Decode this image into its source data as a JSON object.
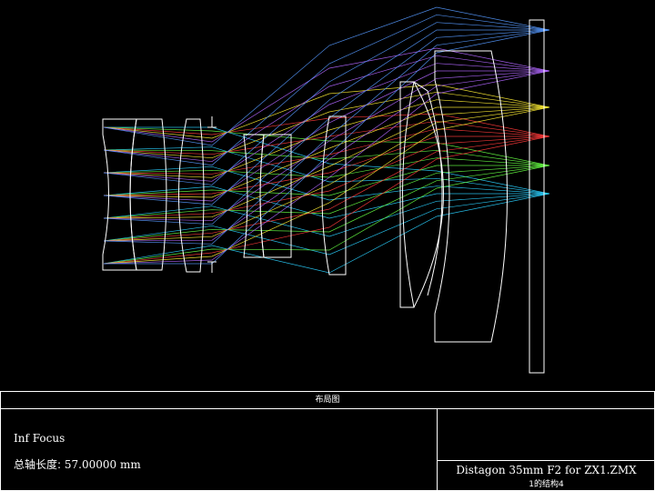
{
  "title_block": {
    "title": "布局图",
    "focus_label": "Inf Focus",
    "length_label": "总轴长度:",
    "length_value": "57.00000 mm",
    "file_name": "Distagon 35mm F2 for ZX1.ZMX",
    "config_label": "1的结构4"
  },
  "rays": [
    {
      "field": 0,
      "color": "#2ad0ff"
    },
    {
      "field": 1,
      "color": "#66ff44"
    },
    {
      "field": 2,
      "color": "#ff3a3a"
    },
    {
      "field": 3,
      "color": "#ffee33"
    },
    {
      "field": 4,
      "color": "#b066ff"
    },
    {
      "field": 5,
      "color": "#5599ff"
    }
  ],
  "colors": {
    "background": "#000000",
    "outline": "#ffffff"
  }
}
